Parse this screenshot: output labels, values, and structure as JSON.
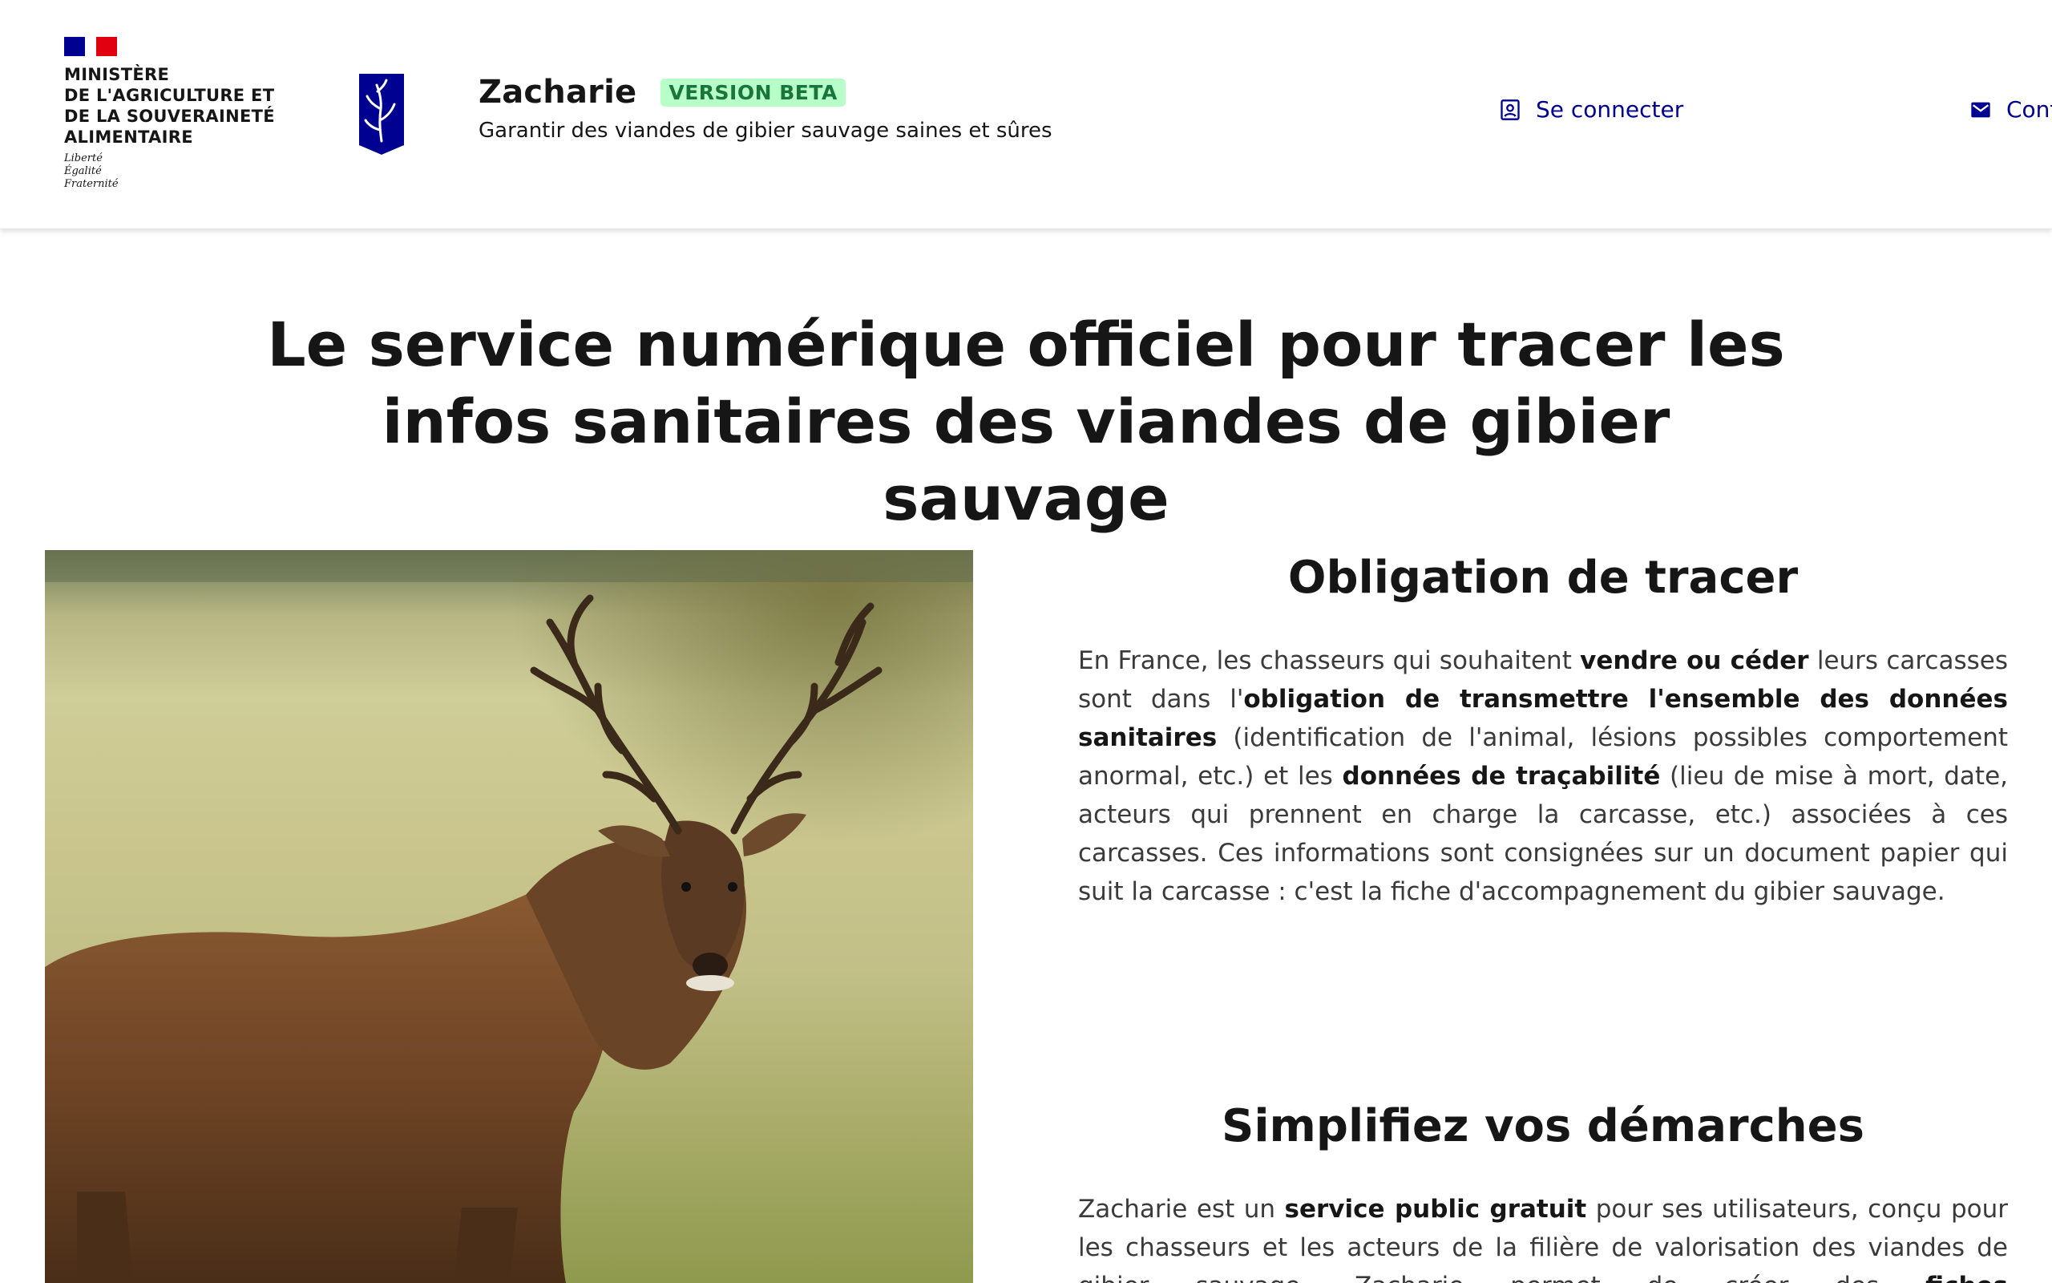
{
  "header": {
    "ministry_name": "Ministère\nde l'agriculture et\nde la souveraineté\nalimentaire",
    "devise": "Liberté\nÉgalité\nFraternité",
    "service_title": "Zacharie",
    "beta_badge": "VERSION BETA",
    "tagline": "Garantir des viandes de gibier sauvage saines et sûres",
    "login_label": "Se connecter",
    "contact_label": "Contact"
  },
  "hero": {
    "title": "Le service numérique officiel pour tracer les infos sanitaires des viandes de gibier sauvage"
  },
  "section1": {
    "heading": "Obligation de tracer",
    "parts": [
      {
        "t": "En France, les chasseurs qui souhaitent ",
        "b": false
      },
      {
        "t": "vendre ou céder",
        "b": true
      },
      {
        "t": " leurs carcasses sont dans l'",
        "b": false
      },
      {
        "t": "obligation de transmettre l'ensemble des données sanitaires",
        "b": true
      },
      {
        "t": " (identification de l'animal, lésions possibles comportement anormal, etc.) et les ",
        "b": false
      },
      {
        "t": "données de traçabilité",
        "b": true
      },
      {
        "t": " (lieu de mise à mort, date, acteurs qui prennent en charge la carcasse, etc.) associées à ces carcasses. Ces informations sont consignées sur un document papier qui suit la carcasse : c'est la fiche d'accompagnement du gibier sauvage.",
        "b": false
      }
    ]
  },
  "section2": {
    "heading": "Simplifiez vos démarches",
    "parts": [
      {
        "t": "Zacharie est un ",
        "b": false
      },
      {
        "t": "service public gratuit",
        "b": true
      },
      {
        "t": " pour ses utilisateurs, conçu pour les chasseurs et les acteurs de la filière de valorisation des viandes de gibier sauvage. Zacharie permet de créer des ",
        "b": false
      },
      {
        "t": "fiches d'accompagnement numériques",
        "b": true
      }
    ]
  },
  "colors": {
    "brand_blue": "#000091",
    "beta_bg": "#b8fec9",
    "beta_text": "#18753c",
    "marianne_red": "#e1000f"
  },
  "icons": {
    "login": "account-circle-icon",
    "contact": "mail-icon",
    "operator": "antler-shield-logo"
  }
}
